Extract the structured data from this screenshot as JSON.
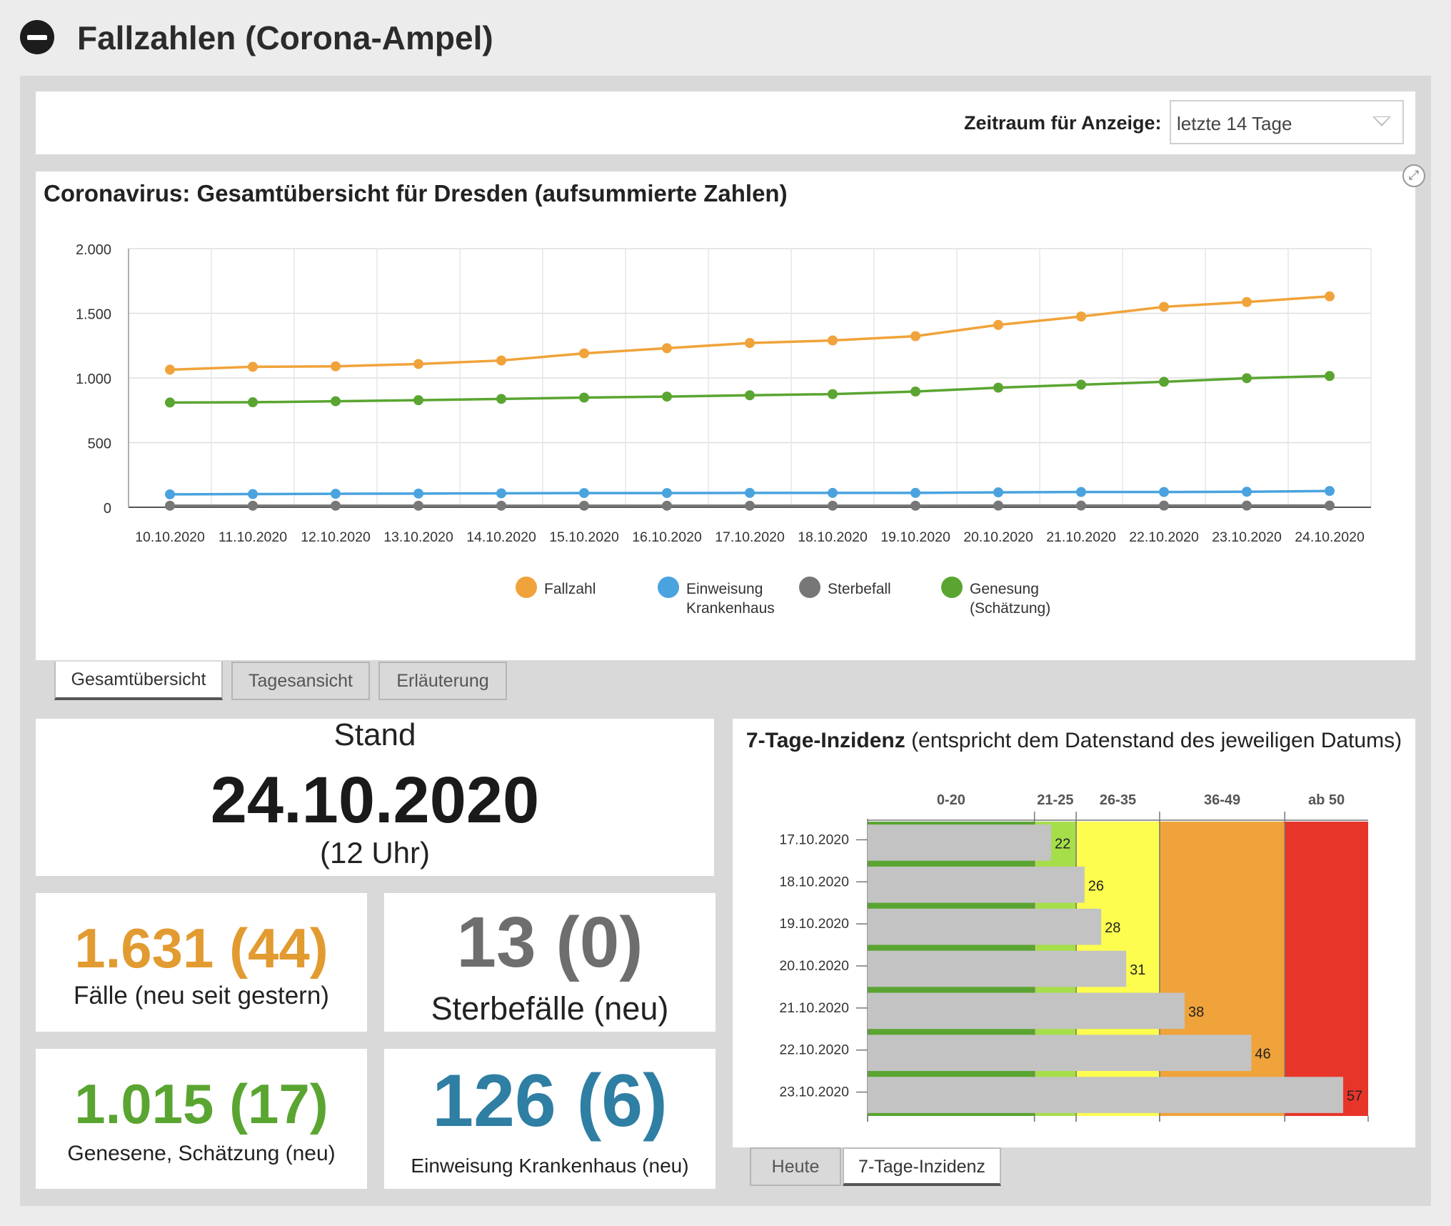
{
  "header": {
    "title": "Fallzahlen (Corona-Ampel)"
  },
  "filter": {
    "label": "Zeitraum für Anzeige:",
    "selected": "letzte 14 Tage"
  },
  "colors": {
    "fallzahl": "#f0a33a",
    "einweisung": "#4aa3df",
    "sterbefall": "#777777",
    "genesung": "#5aa531"
  },
  "chart_data": [
    {
      "type": "line",
      "title": "Coronavirus: Gesamtübersicht für Dresden (aufsummierte Zahlen)",
      "xlabel": "",
      "ylabel": "",
      "ylim": [
        0,
        2000
      ],
      "yticks": [
        "2.000",
        "1.500",
        "1.000",
        "500",
        "0"
      ],
      "categories": [
        "10.10.2020",
        "11.10.2020",
        "12.10.2020",
        "13.10.2020",
        "14.10.2020",
        "15.10.2020",
        "16.10.2020",
        "17.10.2020",
        "18.10.2020",
        "19.10.2020",
        "20.10.2020",
        "21.10.2020",
        "22.10.2020",
        "23.10.2020",
        "24.10.2020"
      ],
      "series": [
        {
          "name": "Fallzahl",
          "color": "#f0a33a",
          "values": [
            1064,
            1086,
            1090,
            1108,
            1135,
            1190,
            1230,
            1270,
            1290,
            1323,
            1410,
            1475,
            1550,
            1587,
            1631
          ]
        },
        {
          "name": "Genesung (Schätzung)",
          "color": "#5aa531",
          "values": [
            810,
            812,
            820,
            828,
            838,
            848,
            856,
            866,
            875,
            895,
            925,
            948,
            970,
            998,
            1015
          ]
        },
        {
          "name": "Einweisung Krankenhaus",
          "color": "#4aa3df",
          "values": [
            100,
            102,
            104,
            106,
            108,
            110,
            110,
            111,
            111,
            111,
            115,
            118,
            118,
            120,
            126
          ]
        },
        {
          "name": "Sterbefall",
          "color": "#777777",
          "values": [
            12,
            12,
            12,
            12,
            12,
            12,
            12,
            12,
            12,
            12,
            13,
            13,
            13,
            13,
            13
          ]
        }
      ],
      "legend_position": "bottom",
      "legend": [
        {
          "line1": "Fallzahl",
          "line2": ""
        },
        {
          "line1": "Einweisung",
          "line2": "Krankenhaus"
        },
        {
          "line1": "Sterbefall",
          "line2": ""
        },
        {
          "line1": "Genesung",
          "line2": "(Schätzung)"
        }
      ],
      "grid": true
    },
    {
      "type": "bar",
      "orientation": "horizontal",
      "title": "7-Tage-Inzidenz",
      "subtitle": "(entspricht dem Datenstand des jeweiligen Datums)",
      "categories": [
        "17.10.2020",
        "18.10.2020",
        "19.10.2020",
        "20.10.2020",
        "21.10.2020",
        "22.10.2020",
        "23.10.2020"
      ],
      "values": [
        22,
        26,
        28,
        31,
        38,
        46,
        57
      ],
      "xlim": [
        0,
        60
      ],
      "bands": [
        {
          "label": "0-20",
          "from": 0,
          "to": 20,
          "color": "#5aa531"
        },
        {
          "label": "21-25",
          "from": 20,
          "to": 25,
          "color": "#a6de4a"
        },
        {
          "label": "26-35",
          "from": 25,
          "to": 35,
          "color": "#fdfd4f"
        },
        {
          "label": "36-49",
          "from": 35,
          "to": 50,
          "color": "#f0a33a"
        },
        {
          "label": "ab 50",
          "from": 50,
          "to": 60,
          "color": "#e8352a"
        }
      ]
    }
  ],
  "chart_tabs": [
    "Gesamtübersicht",
    "Tagesansicht",
    "Erläuterung"
  ],
  "stand": {
    "label": "Stand",
    "date": "24.10.2020",
    "time": "(12 Uhr)"
  },
  "stats": {
    "faelle": {
      "value": "1.631 (44)",
      "label": "Fälle (neu seit gestern)",
      "color": "#e29b30"
    },
    "sterbefaelle": {
      "value": "13 (0)",
      "label": "Sterbefälle (neu)",
      "color": "#6e6e6e"
    },
    "genesene": {
      "value": "1.015 (17)",
      "label": "Genesene, Schätzung (neu)",
      "color": "#5aa531"
    },
    "einweisung": {
      "value": "126 (6)",
      "label": "Einweisung Krankenhaus (neu)",
      "color": "#2f7ea3"
    }
  },
  "incidence_tabs": [
    "Heute",
    "7-Tage-Inzidenz"
  ]
}
